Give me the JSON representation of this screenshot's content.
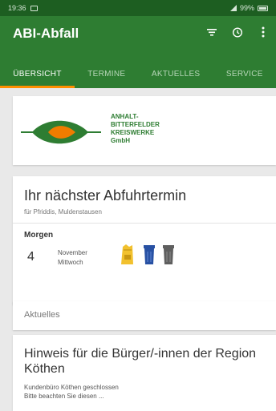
{
  "statusbar": {
    "time": "19:36",
    "battery": "99%",
    "icons": [
      "image-icon",
      "signal-icon",
      "battery-icon"
    ]
  },
  "appbar": {
    "title": "ABI-Abfall",
    "actions": [
      "filter-icon",
      "alarm-icon",
      "overflow-menu-icon"
    ]
  },
  "tabs": [
    "ÜBERSICHT",
    "TERMINE",
    "AKTUELLES",
    "SERVICE"
  ],
  "active_tab": "ÜBERSICHT",
  "logo": {
    "line1": "ANHALT-",
    "line2": "BITTERFELDER",
    "line3": "KREISWERKE",
    "line4": "GmbH"
  },
  "next_pickup": {
    "title": "Ihr nächster Abfuhrtermin",
    "subtitle": "für Pfriddis, Muldenstausen",
    "when": "Morgen",
    "day": "4",
    "month": "November",
    "weekday": "Mittwoch",
    "bins": [
      "yellow-bag-icon",
      "blue-bin-icon",
      "gray-bin-icon"
    ]
  },
  "news": {
    "header": "Aktuelles",
    "title": "Hinweis für die Bürger/-innen der Region Köthen",
    "line1": "Kundenbüro Köthen geschlossen",
    "line2": "Bitte beachten Sie diesen ..."
  },
  "colors": {
    "primary": "#2e7d32",
    "statusbar": "#1d5e21",
    "accent": "#ff8f00",
    "logo_orange": "#f07c00",
    "yellow_bin": "#f2c12e",
    "blue_bin": "#2851a3",
    "gray_bin": "#5f5f5f"
  }
}
